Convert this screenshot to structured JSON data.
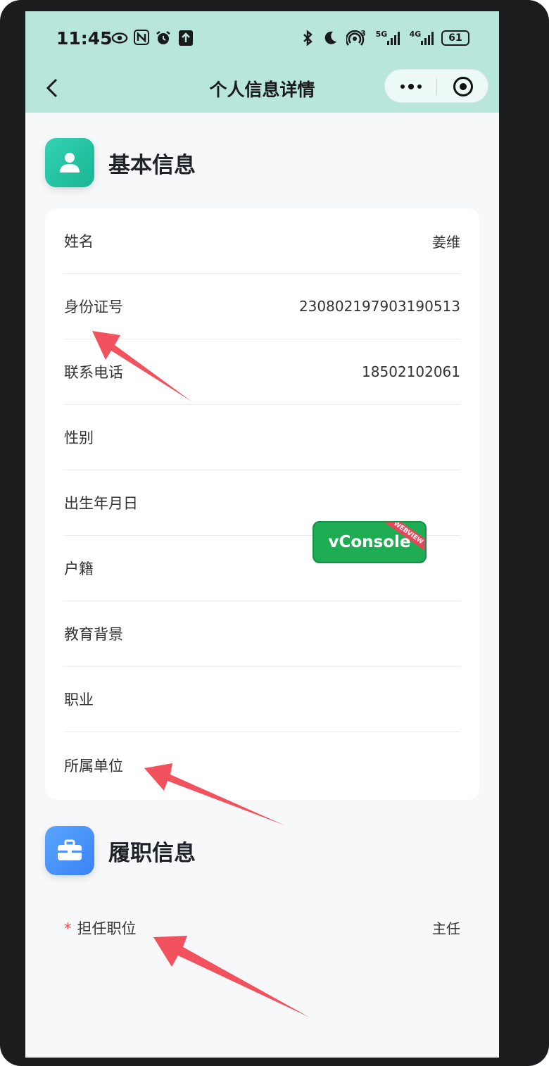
{
  "status_bar": {
    "time": "11:45",
    "icons_left": [
      "eye-icon",
      "nfc-icon",
      "alarm-icon",
      "upload-icon"
    ],
    "icons_right": [
      "bluetooth-icon",
      "moon-icon",
      "hotspot-icon",
      "signal-5g-icon",
      "signal-4g-icon"
    ],
    "signal_5g": "5G",
    "signal_4g": "4G",
    "hotspot_badge": "3",
    "battery": "61"
  },
  "nav": {
    "title": "个人信息详情",
    "back_icon": "chevron-left-icon"
  },
  "basic_section": {
    "title": "基本信息",
    "icon": "user-icon",
    "icon_color": "#1fbf9d",
    "rows": [
      {
        "label": "姓名",
        "value": "姜维"
      },
      {
        "label": "身份证号",
        "value": "230802197903190513"
      },
      {
        "label": "联系电话",
        "value": "18502102061"
      },
      {
        "label": "性别",
        "value": ""
      },
      {
        "label": "出生年月日",
        "value": ""
      },
      {
        "label": "户籍",
        "value": ""
      },
      {
        "label": "教育背景",
        "value": ""
      },
      {
        "label": "职业",
        "value": ""
      },
      {
        "label": "所属单位",
        "value": ""
      }
    ]
  },
  "duty_section": {
    "title": "履职信息",
    "icon": "briefcase-icon",
    "icon_color": "#4a90f5",
    "rows": [
      {
        "required_mark": "*",
        "label": "担任职位",
        "value": "主任"
      }
    ]
  },
  "vconsole": {
    "label": "vConsole",
    "ribbon": "WEBVIEW"
  },
  "colors": {
    "header_bg": "#b8e5dc",
    "annotation_arrow": "#f2515e",
    "required": "#f04a4a"
  }
}
